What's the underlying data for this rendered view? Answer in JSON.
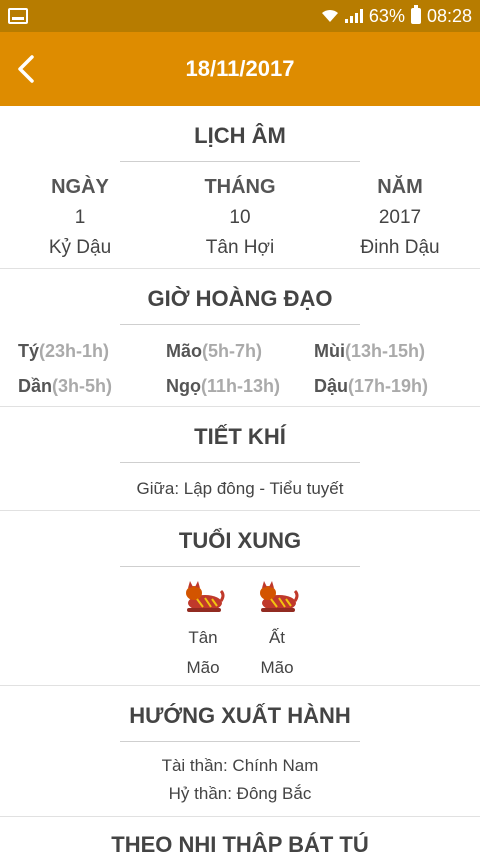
{
  "status_bar": {
    "battery_percent": "63%",
    "time": "08:28"
  },
  "app_bar": {
    "title": "18/11/2017",
    "back_icon": "chevron-left-icon"
  },
  "lich_am": {
    "title": "LỊCH ÂM",
    "columns": [
      {
        "header": "NGÀY",
        "value": "1",
        "can_chi": "Kỷ Dậu"
      },
      {
        "header": "THÁNG",
        "value": "10",
        "can_chi": "Tân Hợi"
      },
      {
        "header": "NĂM",
        "value": "2017",
        "can_chi": "Đinh Dậu"
      }
    ]
  },
  "gio_hoang_dao": {
    "title": "GIỜ HOÀNG ĐẠO",
    "hours": [
      {
        "name": "Tý",
        "time": "(23h-1h)"
      },
      {
        "name": "Mão",
        "time": "(5h-7h)"
      },
      {
        "name": "Mùi",
        "time": "(13h-15h)"
      },
      {
        "name": "Dần",
        "time": "(3h-5h)"
      },
      {
        "name": "Ngọ",
        "time": "(11h-13h)"
      },
      {
        "name": "Dậu",
        "time": "(17h-19h)"
      }
    ]
  },
  "tiet_khi": {
    "title": "TIẾT KHÍ",
    "text": "Giữa: Lập đông - Tiểu tuyết"
  },
  "tuoi_xung": {
    "title": "TUỔI XUNG",
    "items": [
      {
        "line1": "Tân",
        "line2": "Mão",
        "icon": "cat-icon"
      },
      {
        "line1": "Ất",
        "line2": "Mão",
        "icon": "cat-icon"
      }
    ]
  },
  "huong_xuat_hanh": {
    "title": "HƯỚNG XUẤT HÀNH",
    "tai_than": "Tài thần: Chính Nam",
    "hy_than": "Hỷ thần: Đông Bắc"
  },
  "theo_nhi_thap_bat_tu": {
    "title": "THEO NHỊ THẬP BÁT TÚ"
  },
  "colors": {
    "status_bar": "#b77c00",
    "app_bar": "#de8c00"
  }
}
